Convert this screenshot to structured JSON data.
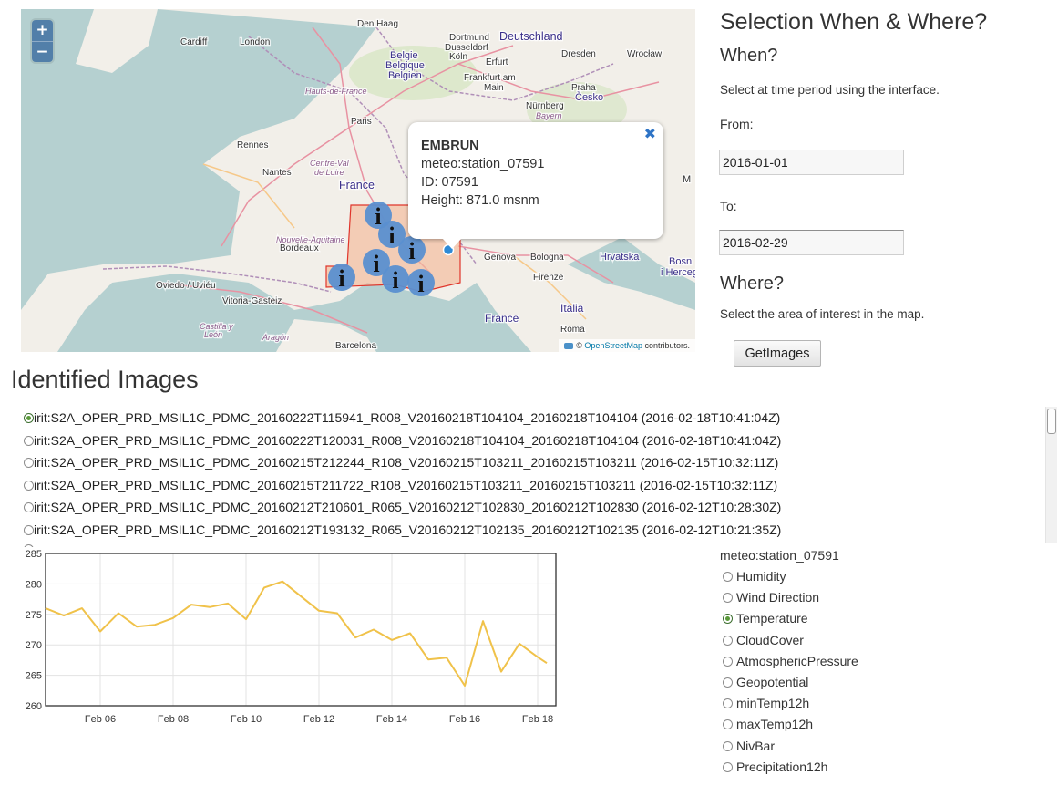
{
  "map": {
    "zoom_in": "+",
    "zoom_out": "−",
    "labels": [
      "Den Haag",
      "Cardiff",
      "London",
      "Belgie",
      "Belgique",
      "Belgien",
      "Dusseldorf",
      "Köln",
      "Dortmund",
      "Deutschland",
      "Erfurt",
      "Dresden",
      "Wrocław",
      "Frankfurt am",
      "Main",
      "Hauts-de-France",
      "Praha",
      "Česko",
      "Nürnberg",
      "Bayern",
      "Paris",
      "Rennes",
      "Nantes",
      "Centre-Val",
      "de Loire",
      "France",
      "Nouvelle-Aquitaine",
      "Bordeaux",
      "Genova",
      "Bologna",
      "Hrvatska",
      "Bosn",
      "i Herceg",
      "Firenze",
      "Oviedo / Uviéu",
      "Vitoria-Gasteiz",
      "Castilla y",
      "León",
      "Aragón",
      "Barcelona",
      "Italia",
      "France",
      "Roma",
      "M"
    ],
    "popup": {
      "title": "EMBRUN",
      "station": "meteo:station_07591",
      "id": "ID: 07591",
      "height": "Height: 871.0 msnm",
      "close": "✖"
    },
    "attribution": {
      "copyright": "©",
      "link": "OpenStreetMap",
      "rest": " contributors."
    },
    "colors": {
      "selection_border": "#e0352b",
      "selection_fill": "#f3b89a",
      "marker": "#2e6fb8"
    }
  },
  "selection": {
    "title": "Selection When & Where?",
    "when_title": "When?",
    "when_help": "Select at time period using the interface.",
    "from_label": "From:",
    "from_value": "2016-01-01",
    "to_label": "To:",
    "to_value": "2016-02-29",
    "where_title": "Where?",
    "where_help": "Select the area of interest in the map.",
    "button": "GetImages"
  },
  "images": {
    "title": "Identified Images",
    "items": [
      {
        "name": "irit:S2A_OPER_PRD_MSIL1C_PDMC_20160222T115941_R008_V20160218T104104_20160218T104104 (2016-02-18T10:41:04Z)",
        "selected": true
      },
      {
        "name": "irit:S2A_OPER_PRD_MSIL1C_PDMC_20160222T120031_R008_V20160218T104104_20160218T104104 (2016-02-18T10:41:04Z)",
        "selected": false
      },
      {
        "name": "irit:S2A_OPER_PRD_MSIL1C_PDMC_20160215T212244_R108_V20160215T103211_20160215T103211 (2016-02-15T10:32:11Z)",
        "selected": false
      },
      {
        "name": "irit:S2A_OPER_PRD_MSIL1C_PDMC_20160215T211722_R108_V20160215T103211_20160215T103211 (2016-02-15T10:32:11Z)",
        "selected": false
      },
      {
        "name": "irit:S2A_OPER_PRD_MSIL1C_PDMC_20160212T210601_R065_V20160212T102830_20160212T102830 (2016-02-12T10:28:30Z)",
        "selected": false
      },
      {
        "name": "irit:S2A_OPER_PRD_MSIL1C_PDMC_20160212T193132_R065_V20160212T102135_20160212T102135 (2016-02-12T10:21:35Z)",
        "selected": false
      }
    ]
  },
  "chart_data": {
    "type": "line",
    "x": [
      "2016-02-04T12:00",
      "2016-02-05T00:00",
      "2016-02-05T12:00",
      "2016-02-06T00:00",
      "2016-02-06T12:00",
      "2016-02-07T00:00",
      "2016-02-07T12:00",
      "2016-02-08T00:00",
      "2016-02-08T12:00",
      "2016-02-09T00:00",
      "2016-02-09T12:00",
      "2016-02-10T00:00",
      "2016-02-10T12:00",
      "2016-02-11T00:00",
      "2016-02-11T12:00",
      "2016-02-12T00:00",
      "2016-02-12T12:00",
      "2016-02-13T00:00",
      "2016-02-13T12:00",
      "2016-02-14T00:00",
      "2016-02-14T12:00",
      "2016-02-15T00:00",
      "2016-02-15T12:00",
      "2016-02-16T00:00",
      "2016-02-16T12:00",
      "2016-02-17T00:00",
      "2016-02-17T12:00",
      "2016-02-18T00:00",
      "2016-02-18T06:00"
    ],
    "series": [
      {
        "values": [
          276.0,
          274.8,
          276.0,
          272.2,
          275.2,
          273.0,
          273.3,
          274.4,
          276.6,
          276.2,
          276.8,
          274.2,
          279.4,
          280.4,
          278.0,
          275.6,
          275.2,
          271.2,
          272.5,
          270.8,
          271.9,
          267.6,
          267.9,
          263.3,
          273.9,
          265.6,
          270.2,
          268.0,
          267.0
        ]
      }
    ],
    "xticks": [
      "Feb 06",
      "Feb 08",
      "Feb 10",
      "Feb 12",
      "Feb 14",
      "Feb 16",
      "Feb 18"
    ],
    "xtick_dates": [
      "2016-02-06",
      "2016-02-08",
      "2016-02-10",
      "2016-02-12",
      "2016-02-14",
      "2016-02-16",
      "2016-02-18"
    ],
    "yticks": [
      260,
      265,
      270,
      275,
      280,
      285
    ],
    "ylim": [
      260,
      285
    ],
    "xlim": [
      "2016-02-04T12:00",
      "2016-02-18T12:00"
    ],
    "grid": true,
    "color": "#f0c24a"
  },
  "variables": {
    "station": "meteo:station_07591",
    "items": [
      {
        "label": "Humidity",
        "selected": false
      },
      {
        "label": "Wind Direction",
        "selected": false
      },
      {
        "label": "Temperature",
        "selected": true
      },
      {
        "label": "CloudCover",
        "selected": false
      },
      {
        "label": "AtmosphericPressure",
        "selected": false
      },
      {
        "label": "Geopotential",
        "selected": false
      },
      {
        "label": "minTemp12h",
        "selected": false
      },
      {
        "label": "maxTemp12h",
        "selected": false
      },
      {
        "label": "NivBar",
        "selected": false
      },
      {
        "label": "Precipitation12h",
        "selected": false
      }
    ]
  }
}
